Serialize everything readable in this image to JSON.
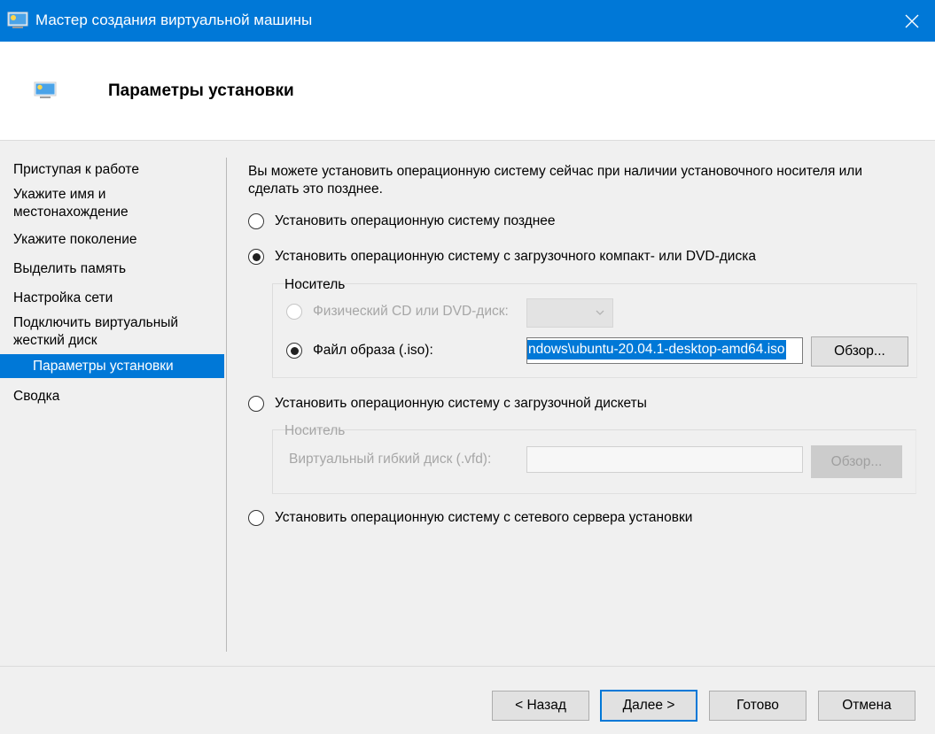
{
  "window": {
    "title": "Мастер создания виртуальной машины",
    "icon": "vm-monitor-icon",
    "close_glyph": "✕"
  },
  "header": {
    "title": "Параметры установки",
    "icon": "vm-monitor-icon"
  },
  "nav": {
    "items": [
      {
        "label": "Приступая к работе"
      },
      {
        "label": "Укажите имя и местонахождение"
      },
      {
        "label": "Укажите поколение"
      },
      {
        "label": "Выделить память"
      },
      {
        "label": "Настройка сети"
      },
      {
        "label": "Подключить виртуальный жесткий диск"
      },
      {
        "label": "Параметры установки",
        "active": true
      },
      {
        "label": "Сводка"
      }
    ]
  },
  "content": {
    "intro": "Вы можете установить операционную систему сейчас при наличии установочного носителя или сделать это позднее.",
    "options": {
      "later": {
        "label": "Установить операционную систему позднее",
        "checked": false
      },
      "dvd": {
        "label": "Установить операционную систему с загрузочного компакт- или DVD-диска",
        "checked": true
      },
      "floppy": {
        "label": "Установить операционную систему с загрузочной дискеты",
        "checked": false
      },
      "network": {
        "label": "Установить операционную систему с сетевого сервера установки",
        "checked": false
      }
    },
    "dvd_group": {
      "title": "Носитель",
      "physical_label": "Физический CD или DVD-диск:",
      "physical_checked": false,
      "physical_enabled": false,
      "iso_label": "Файл образа (.iso):",
      "iso_checked": true,
      "iso_value": "ndows\\ubuntu-20.04.1-desktop-amd64.iso",
      "browse_label": "Обзор..."
    },
    "floppy_group": {
      "title": "Носитель",
      "vfd_label": "Виртуальный гибкий диск (.vfd):",
      "vfd_value": "",
      "browse_label": "Обзор...",
      "enabled": false
    }
  },
  "footer": {
    "back_label": "< Назад",
    "next_label": "Далее >",
    "finish_label": "Готово",
    "cancel_label": "Отмена"
  },
  "colors": {
    "accent": "#0078d7",
    "window_bg": "#f0f0f0",
    "disabled_text": "#a6a6a6"
  }
}
